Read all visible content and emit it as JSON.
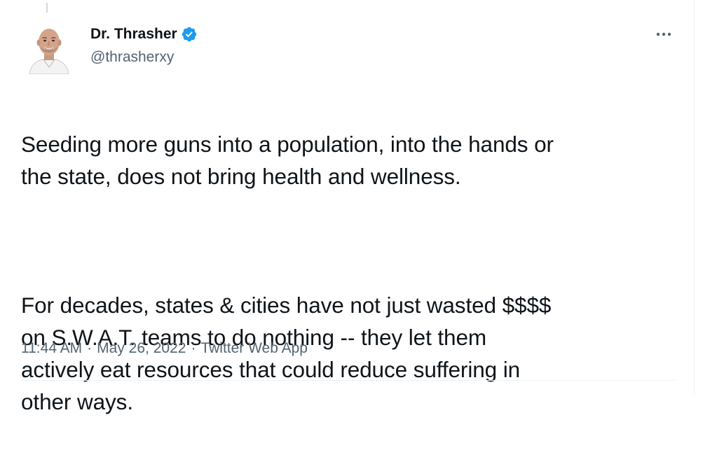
{
  "tweet": {
    "author": {
      "display_name": "Dr. Thrasher",
      "handle": "@thrasherxy",
      "verified": true,
      "avatar_icon": "user-avatar",
      "verified_icon": "verified-badge-icon"
    },
    "more_icon": "more-options-icon",
    "text_paragraphs": [
      "Seeding more guns into a population, into the hands or\nthe state, does not bring health and wellness.",
      "For decades, states & cities have not just wasted $$$$\non S.W.A.T. teams to do nothing -- they let them\nactively eat resources that could reduce suffering in\nother ways."
    ],
    "meta": {
      "time": "11:44 AM",
      "separator": "·",
      "date": "May 26, 2022",
      "source": "Twitter Web App"
    }
  },
  "colors": {
    "text_primary": "#0f1419",
    "text_secondary": "#536471",
    "verified_blue": "#1d9bf0",
    "divider": "#eff3f4"
  }
}
